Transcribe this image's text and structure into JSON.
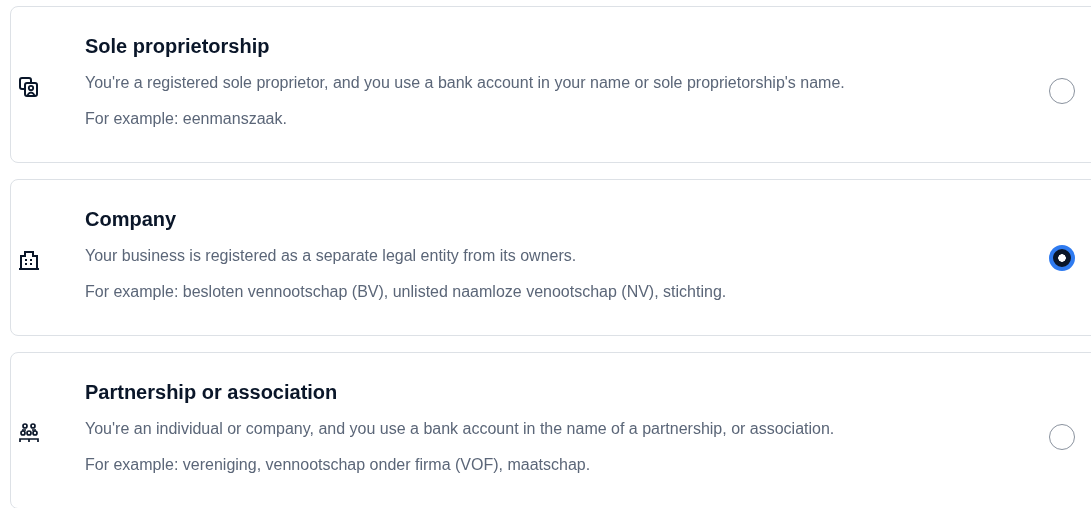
{
  "options": [
    {
      "kind": "person",
      "title": "Sole proprietorship",
      "description": "You're a registered sole proprietor, and you use a bank account in your name or sole proprietorship's name.",
      "example": "For example: eenmanszaak.",
      "selected": false
    },
    {
      "kind": "building",
      "title": "Company",
      "description": "Your business is registered as a separate legal entity from its owners.",
      "example": "For example: besloten vennootschap (BV), unlisted naamloze venootschap (NV), stichting.",
      "selected": true
    },
    {
      "kind": "group",
      "title": "Partnership or association",
      "description": "You're an individual or company, and you use a bank account in the name of a partnership, or association.",
      "example": "For example: vereniging, vennootschap onder firma (VOF), maatschap.",
      "selected": false
    }
  ]
}
